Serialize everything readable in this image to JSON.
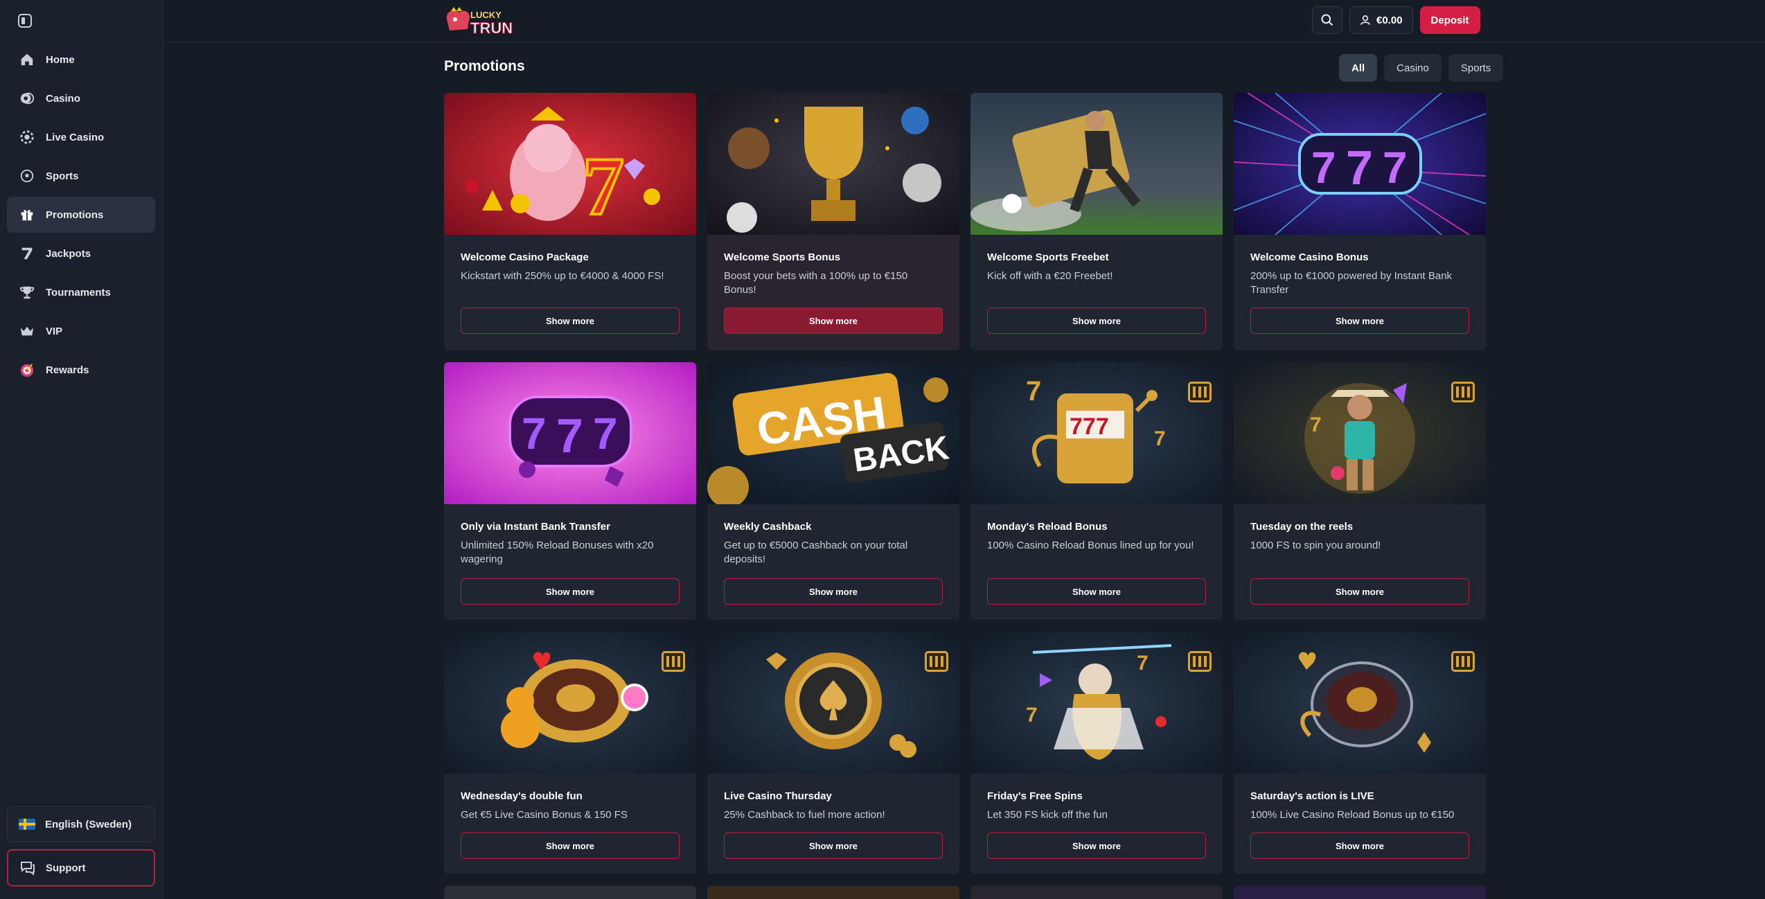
{
  "sidebar": {
    "items": [
      {
        "label": "Home",
        "icon": "home-icon"
      },
      {
        "label": "Casino",
        "icon": "casino-chip-icon"
      },
      {
        "label": "Live Casino",
        "icon": "live-casino-icon"
      },
      {
        "label": "Sports",
        "icon": "soccer-ball-icon"
      },
      {
        "label": "Promotions",
        "icon": "gift-icon",
        "active": true
      },
      {
        "label": "Jackpots",
        "icon": "seven-icon"
      },
      {
        "label": "Tournaments",
        "icon": "trophy-icon"
      },
      {
        "label": "VIP",
        "icon": "crown-icon"
      },
      {
        "label": "Rewards",
        "icon": "rewards-target-icon"
      }
    ],
    "language": "English (Sweden)",
    "support": "Support"
  },
  "header": {
    "logo_text_top": "LUCKY",
    "logo_text_bottom": "TRUNK",
    "balance": "€0.00",
    "deposit": "Deposit"
  },
  "main": {
    "title": "Promotions",
    "filters": [
      {
        "label": "All",
        "active": true
      },
      {
        "label": "Casino",
        "active": false
      },
      {
        "label": "Sports",
        "active": false
      }
    ],
    "cards": [
      {
        "title": "Welcome Casino Package",
        "desc": "Kickstart with 250% up to €4000 & 4000 FS!",
        "button": "Show more",
        "theme": "red"
      },
      {
        "title": "Welcome Sports Bonus",
        "desc": "Boost your bets with a 100% up to €150 Bonus!",
        "button": "Show more",
        "theme": "trophy",
        "highlight": true
      },
      {
        "title": "Welcome Sports Freebet",
        "desc": "Kick off with a €20 Freebet!",
        "button": "Show more",
        "theme": "stadium"
      },
      {
        "title": "Welcome Casino Bonus",
        "desc": "200% up to €1000 powered by Instant Bank Transfer",
        "button": "Show more",
        "theme": "neon"
      },
      {
        "title": "Only via Instant Bank Transfer",
        "desc": "Unlimited 150% Reload Bonuses with x20 wagering",
        "button": "Show more",
        "theme": "pink"
      },
      {
        "title": "Weekly Cashback",
        "desc": "Get up to €5000 Cashback on your total deposits!",
        "button": "Show more",
        "theme": "cashback"
      },
      {
        "title": "Monday's Reload Bonus",
        "desc": "100% Casino Reload Bonus lined up for you!",
        "button": "Show more",
        "theme": "slot"
      },
      {
        "title": "Tuesday on the reels",
        "desc": "1000 FS to spin you around!",
        "button": "Show more",
        "theme": "cowboy"
      },
      {
        "title": "Wednesday's double fun",
        "desc": "Get €5 Live Casino Bonus & 150 FS",
        "button": "Show more",
        "theme": "roulette-bear"
      },
      {
        "title": "Live Casino Thursday",
        "desc": "25% Cashback to fuel more action!",
        "button": "Show more",
        "theme": "chip"
      },
      {
        "title": "Friday's Free Spins",
        "desc": "Let 350 FS kick off the fun",
        "button": "Show more",
        "theme": "zeus"
      },
      {
        "title": "Saturday's action is LIVE",
        "desc": "100% Live Casino Reload Bonus up to €150",
        "button": "Show more",
        "theme": "roulette"
      }
    ],
    "cashback_text_1": "CASH",
    "cashback_text_2": "BACK"
  },
  "colors": {
    "accent": "#d41e44",
    "background": "#161c26",
    "card": "#1f2632"
  }
}
